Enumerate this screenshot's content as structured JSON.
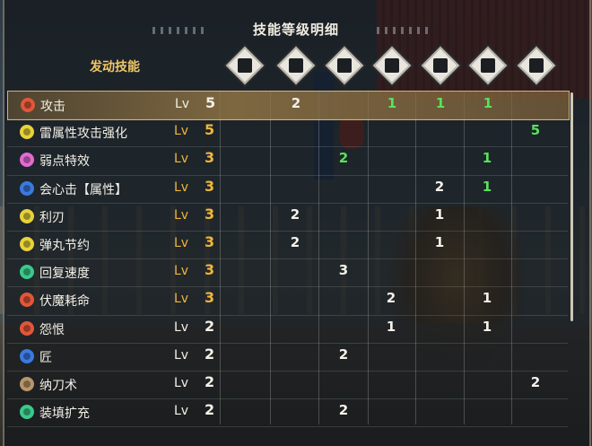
{
  "title": "技能等级明细",
  "section_label": "发动技能",
  "equipment_icons": [
    "weapon-icon",
    "helm-icon",
    "chest-icon",
    "arms-icon",
    "waist-icon",
    "legs-icon",
    "talisman-icon"
  ],
  "level_prefix": "Lv",
  "skills": [
    {
      "name": "攻击",
      "icon_color": "#e0573a",
      "level": "5",
      "max": false,
      "cells": [
        "",
        "2",
        "",
        "1",
        "1",
        "1",
        ""
      ],
      "green": [
        false,
        false,
        false,
        true,
        true,
        true,
        false
      ]
    },
    {
      "name": "雷属性攻击强化",
      "icon_color": "#e6d23a",
      "level": "5",
      "max": true,
      "cells": [
        "",
        "",
        "",
        "",
        "",
        "",
        "5"
      ],
      "green": [
        false,
        false,
        false,
        false,
        false,
        false,
        true
      ]
    },
    {
      "name": "弱点特效",
      "icon_color": "#e26bd0",
      "level": "3",
      "max": true,
      "cells": [
        "",
        "",
        "2",
        "",
        "",
        "1",
        ""
      ],
      "green": [
        false,
        false,
        true,
        false,
        false,
        true,
        false
      ]
    },
    {
      "name": "会心击【属性】",
      "icon_color": "#3a7ae0",
      "level": "3",
      "max": true,
      "cells": [
        "",
        "",
        "",
        "",
        "2",
        "1",
        ""
      ],
      "green": [
        false,
        false,
        false,
        false,
        false,
        true,
        false
      ]
    },
    {
      "name": "利刃",
      "icon_color": "#e6d23a",
      "level": "3",
      "max": true,
      "cells": [
        "",
        "2",
        "",
        "",
        "1",
        "",
        ""
      ],
      "green": [
        false,
        false,
        false,
        false,
        false,
        false,
        false
      ]
    },
    {
      "name": "弹丸节约",
      "icon_color": "#e6d23a",
      "level": "3",
      "max": true,
      "cells": [
        "",
        "2",
        "",
        "",
        "1",
        "",
        ""
      ],
      "green": [
        false,
        false,
        false,
        false,
        false,
        false,
        false
      ]
    },
    {
      "name": "回复速度",
      "icon_color": "#3ac98a",
      "level": "3",
      "max": true,
      "cells": [
        "",
        "",
        "3",
        "",
        "",
        "",
        ""
      ],
      "green": [
        false,
        false,
        false,
        false,
        false,
        false,
        false
      ]
    },
    {
      "name": "伏魔耗命",
      "icon_color": "#e0573a",
      "level": "3",
      "max": true,
      "cells": [
        "",
        "",
        "",
        "2",
        "",
        "1",
        ""
      ],
      "green": [
        false,
        false,
        false,
        false,
        false,
        false,
        false
      ]
    },
    {
      "name": "怨恨",
      "icon_color": "#e0573a",
      "level": "2",
      "max": false,
      "cells": [
        "",
        "",
        "",
        "1",
        "",
        "1",
        ""
      ],
      "green": [
        false,
        false,
        false,
        false,
        false,
        false,
        false
      ]
    },
    {
      "name": "匠",
      "icon_color": "#3a7ae0",
      "level": "2",
      "max": false,
      "cells": [
        "",
        "",
        "2",
        "",
        "",
        "",
        ""
      ],
      "green": [
        false,
        false,
        false,
        false,
        false,
        false,
        false
      ]
    },
    {
      "name": "纳刀术",
      "icon_color": "#b8956a",
      "level": "2",
      "max": false,
      "cells": [
        "",
        "",
        "",
        "",
        "",
        "",
        "2"
      ],
      "green": [
        false,
        false,
        false,
        false,
        false,
        false,
        false
      ]
    },
    {
      "name": "装填扩充",
      "icon_color": "#3ac98a",
      "level": "2",
      "max": false,
      "cells": [
        "",
        "",
        "2",
        "",
        "",
        "",
        ""
      ],
      "green": [
        false,
        false,
        false,
        false,
        false,
        false,
        false
      ]
    }
  ]
}
